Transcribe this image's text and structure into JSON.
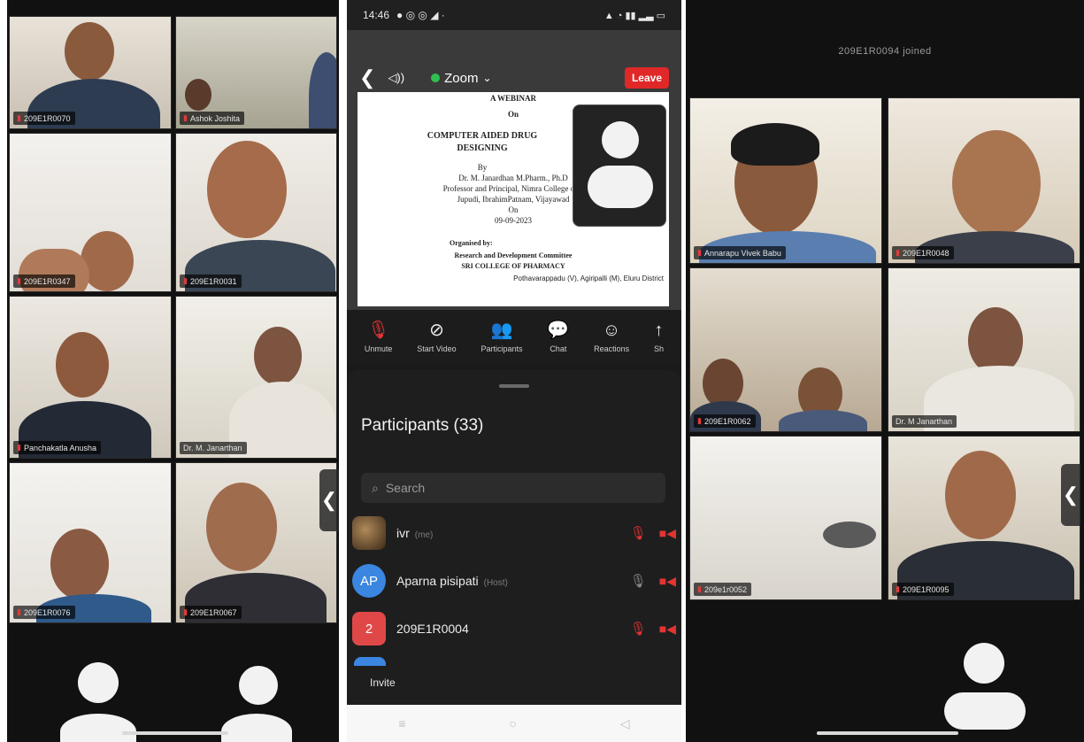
{
  "left_phone": {
    "tiles": [
      {
        "label": "209E1R0070"
      },
      {
        "label": "Ashok Joshita"
      },
      {
        "label": "209E1R0347"
      },
      {
        "label": "209E1R0031"
      },
      {
        "label": "Panchakatla Anusha"
      },
      {
        "label": "Dr. M. Janarthan"
      },
      {
        "label": "209E1R0076"
      },
      {
        "label": "209E1R0067"
      }
    ],
    "side_tab": "❮"
  },
  "middle_phone": {
    "status": {
      "time": "14:46",
      "icons_left": "● ◎ ◎ ◢ ·",
      "icons_right": "▲ ◔ ▮▮ ▂▃ ▭"
    },
    "topbar": {
      "back": "❮",
      "speaker": "◁))",
      "app_name": "Zoom",
      "chevron": "⌄",
      "leave": "Leave"
    },
    "slide": {
      "l1": "A WEBINAR",
      "l2": "On",
      "l3": "COMPUTER AIDED DRUG",
      "l4": "DESIGNING",
      "l5": "By",
      "l6": "Dr. M. Janardhan M.Pharm., Ph.D",
      "l7": "Professor and Principal, Nimra College of P",
      "l8": "Jupudi, IbrahimPatnam, Vijayawad",
      "l9": "On",
      "l10": "09-09-2023",
      "l11": "Organised by:",
      "l12": "Research and Development Committee",
      "l13": "SRI COLLEGE OF PHARMACY",
      "l14": "Pothavarappadu (V), Agiripalli (M), Eluru District"
    },
    "toolbar": [
      {
        "icon": "🎙",
        "label": "Unmute"
      },
      {
        "icon": "⊘",
        "label": "Start Video"
      },
      {
        "icon": "👥",
        "label": "Participants"
      },
      {
        "icon": "💬",
        "label": "Chat"
      },
      {
        "icon": "☺",
        "label": "Reactions"
      },
      {
        "icon": "↑",
        "label": "Sh"
      }
    ],
    "participants": {
      "title": "Participants (33)",
      "search_icon": "⌕",
      "search_placeholder": "Search",
      "rows": [
        {
          "avatar": "",
          "name": "ivr",
          "role": "(me)",
          "avatar_color": "#6b4a2a",
          "mic": "muted"
        },
        {
          "avatar": "AP",
          "name": "Aparna pisipati",
          "role": "(Host)",
          "avatar_color": "#3a86e0",
          "mic": "grey"
        },
        {
          "avatar": "2",
          "name": "209E1R0004",
          "role": "",
          "avatar_color": "#e04848",
          "mic": "muted"
        }
      ],
      "invite": "Invite"
    },
    "nav": [
      "≡",
      "○",
      "◁"
    ]
  },
  "right_phone": {
    "banner": "209E1R0094 joined",
    "tiles": [
      {
        "label": "Annarapu Vivek Babu"
      },
      {
        "label": "209E1R0048"
      },
      {
        "label": "209E1R0062"
      },
      {
        "label": "Dr. M Janarthan"
      },
      {
        "label": "209e1r0052"
      },
      {
        "label": "209E1R0095"
      }
    ],
    "side_tab": "❮"
  },
  "colors": {
    "leave": "#e02828",
    "muted": "#e33434",
    "zoom_green": "#2fbf4f"
  }
}
